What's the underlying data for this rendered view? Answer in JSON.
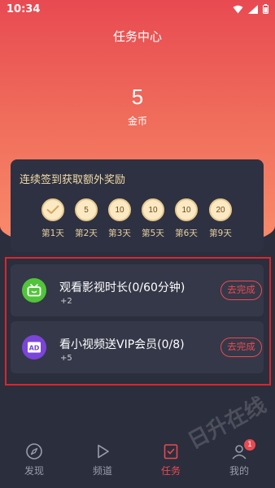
{
  "status_bar": {
    "time": "10:34",
    "icons": [
      "wifi-icon",
      "signal-icon",
      "battery-icon"
    ]
  },
  "header": {
    "title": "任务中心",
    "coin_count": "5",
    "coin_label": "金币"
  },
  "signin": {
    "title": "连续签到获取额外奖励",
    "days": [
      {
        "reward": "",
        "label": "第1天",
        "checked": true
      },
      {
        "reward": "5",
        "label": "第2天",
        "checked": false
      },
      {
        "reward": "10",
        "label": "第3天",
        "checked": false
      },
      {
        "reward": "10",
        "label": "第5天",
        "checked": false
      },
      {
        "reward": "10",
        "label": "第6天",
        "checked": false
      },
      {
        "reward": "20",
        "label": "第9天",
        "checked": false
      }
    ]
  },
  "tasks": [
    {
      "title": "观看影视时长(0/60分钟)",
      "reward": "+2",
      "button": "去完成",
      "icon": "tv-icon"
    },
    {
      "title": "看小视频送VIP会员(0/8)",
      "reward": "+5",
      "button": "去完成",
      "icon": "ad-icon"
    }
  ],
  "tabbar": {
    "items": [
      {
        "label": "发现",
        "icon": "compass-icon",
        "active": false
      },
      {
        "label": "频道",
        "icon": "play-icon",
        "active": false
      },
      {
        "label": "任务",
        "icon": "task-icon",
        "active": true
      },
      {
        "label": "我的",
        "icon": "profile-icon",
        "active": false
      }
    ],
    "badge": "1"
  },
  "watermark": "日升在线",
  "colors": {
    "accent": "#e84a52",
    "background": "#2b2e3d",
    "card": "#353848",
    "gold_text": "#f2dca6",
    "highlight_border": "#d9272d"
  }
}
